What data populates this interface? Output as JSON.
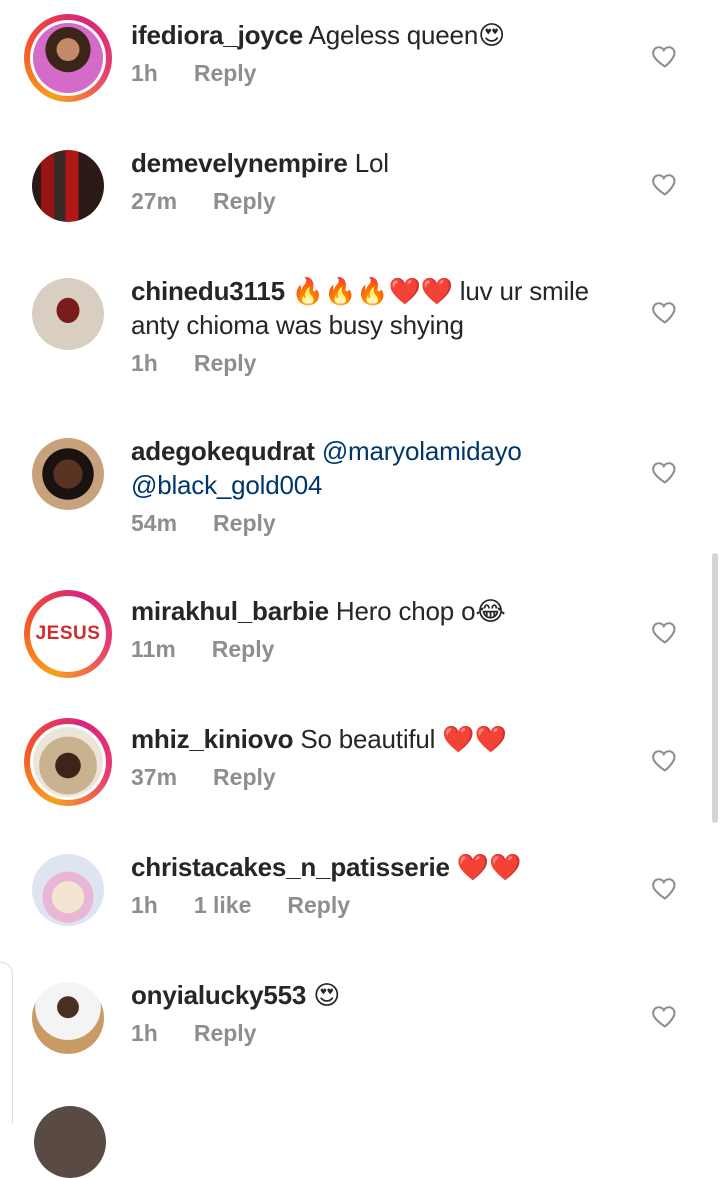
{
  "comments": [
    {
      "username": "ifediora_joyce",
      "text": "Ageless queen😍",
      "time": "1h",
      "likes": "",
      "reply": "Reply"
    },
    {
      "username": "demevelynempire",
      "text": "Lol",
      "time": "27m",
      "likes": "",
      "reply": "Reply"
    },
    {
      "username": "chinedu3115",
      "text": "🔥🔥🔥❤️❤️ luv ur smile",
      "text2": "anty chioma was busy shying",
      "time": "1h",
      "likes": "",
      "reply": "Reply"
    },
    {
      "username": "adegokequdrat",
      "mention1": "@maryolamidayo",
      "mention2": "@black_gold004",
      "time": "54m",
      "likes": "",
      "reply": "Reply"
    },
    {
      "username": "mirakhul_barbie",
      "text": "Hero chop o😂",
      "time": "11m",
      "likes": "",
      "reply": "Reply"
    },
    {
      "username": "mhiz_kiniovo",
      "text": "So beautiful ❤️❤️",
      "time": "37m",
      "likes": "",
      "reply": "Reply"
    },
    {
      "username": "christacakes_n_patisserie",
      "text": "❤️❤️",
      "time": "1h",
      "likes": "1 like",
      "reply": "Reply"
    },
    {
      "username": "onyialucky553",
      "text": "😍",
      "time": "1h",
      "likes": "",
      "reply": "Reply"
    }
  ],
  "avatar_text": {
    "jesus": "JESUS"
  },
  "colors": {
    "mention": "#00376b",
    "meta": "#8e8e8e",
    "username": "#262626"
  }
}
